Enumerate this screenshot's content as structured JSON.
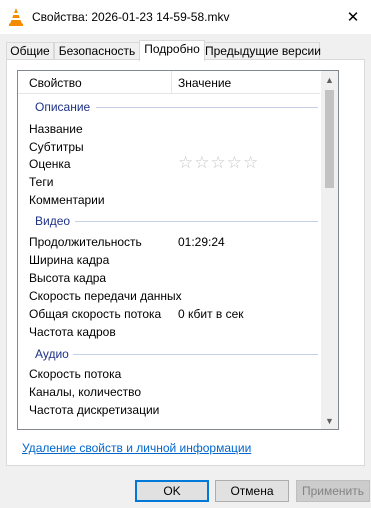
{
  "window": {
    "title": "Свойства: 2026-01-23 14-59-58.mkv",
    "close_glyph": "✕"
  },
  "tabs": [
    {
      "label": "Общие"
    },
    {
      "label": "Безопасность"
    },
    {
      "label": "Подробно"
    },
    {
      "label": "Предыдущие версии"
    }
  ],
  "list": {
    "col_property": "Свойство",
    "col_value": "Значение",
    "groups": {
      "description": "Описание",
      "video": "Видео",
      "audio": "Аудио"
    },
    "rows": {
      "name": "Название",
      "subtitles": "Субтитры",
      "rating": "Оценка",
      "rating_stars": "☆☆☆☆☆",
      "tags": "Теги",
      "comments": "Комментарии",
      "duration": "Продолжительность",
      "duration_value": "01:29:24",
      "frame_width": "Ширина кадра",
      "frame_height": "Высота кадра",
      "data_rate": "Скорость передачи данных",
      "total_bitrate": "Общая скорость потока",
      "total_bitrate_value": "0 кбит в сек",
      "frame_rate": "Частота кадров",
      "bitrate": "Скорость потока",
      "channels": "Каналы, количество",
      "sample_rate": "Частота дискретизации"
    }
  },
  "remove_link": "Удаление свойств и личной информации",
  "buttons": {
    "ok": "OK",
    "cancel": "Отмена",
    "apply": "Применить"
  }
}
